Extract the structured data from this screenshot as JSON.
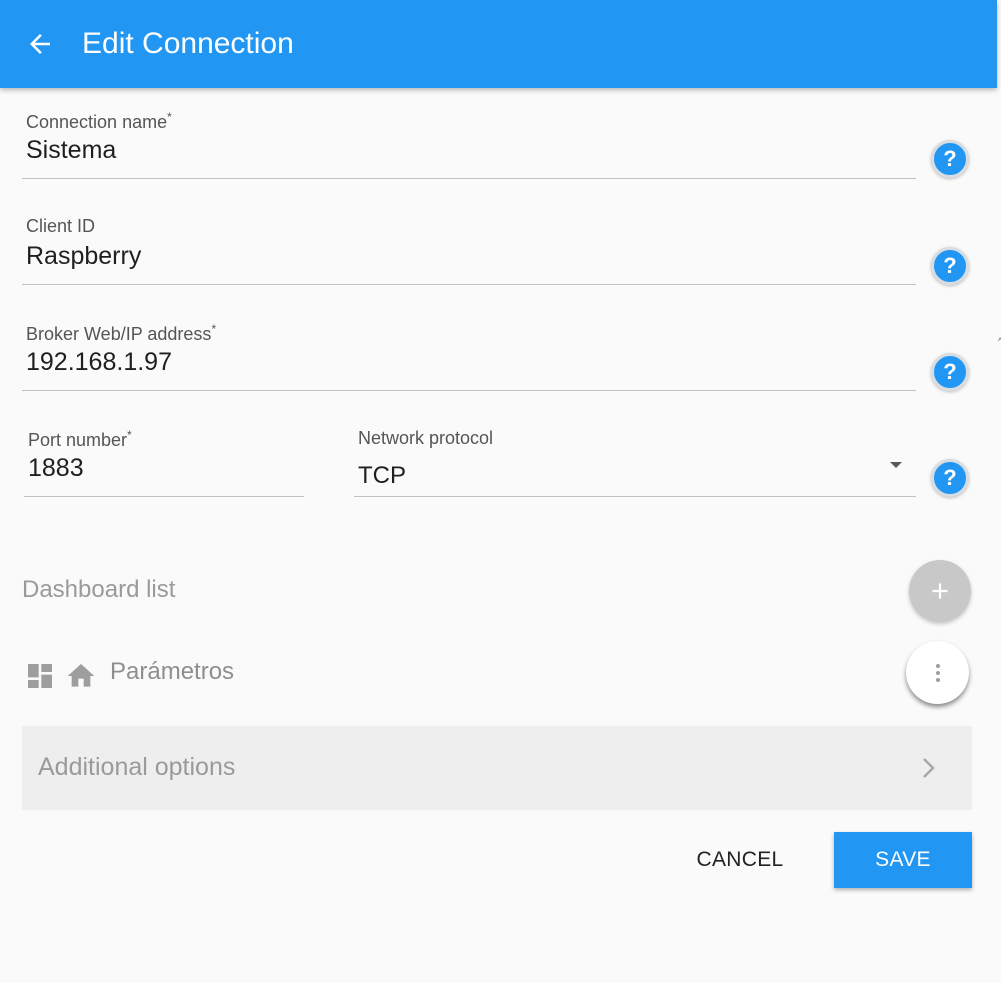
{
  "appbar": {
    "title": "Edit Connection",
    "back_icon": "arrow-left-icon",
    "color": "#2196f3"
  },
  "form": {
    "connection_name": {
      "label": "Connection name",
      "required_mark": "*",
      "value": "Sistema"
    },
    "client_id": {
      "label": "Client ID",
      "value": "Raspberry"
    },
    "broker_address": {
      "label": "Broker Web/IP address",
      "required_mark": "*",
      "value": "192.168.1.97"
    },
    "port_number": {
      "label": "Port number",
      "required_mark": "*",
      "value": "1883"
    },
    "network_protocol": {
      "label": "Network protocol",
      "value": "TCP"
    },
    "help_icon": "help-circle-icon"
  },
  "dashboards": {
    "title": "Dashboard list",
    "add_icon": "plus-icon",
    "items": [
      {
        "name": "Parámetros",
        "icons": [
          "dashboard-icon",
          "home-icon"
        ],
        "menu_icon": "more-vertical-icon"
      }
    ]
  },
  "additional_options": {
    "label": "Additional options",
    "icon": "chevron-right-icon"
  },
  "actions": {
    "cancel_label": "CANCEL",
    "save_label": "SAVE"
  },
  "colors": {
    "accent": "#2196f3",
    "background": "#fafafa"
  }
}
